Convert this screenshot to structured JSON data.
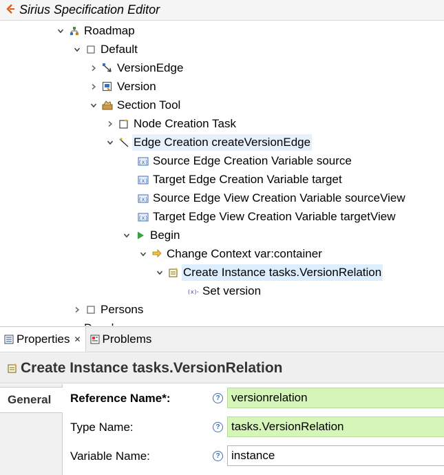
{
  "editor": {
    "title": "Sirius Specification Editor"
  },
  "tree": {
    "rows": [
      {
        "label": "Roadmap"
      },
      {
        "label": "Default"
      },
      {
        "label": "VersionEdge"
      },
      {
        "label": "Version"
      },
      {
        "label": "Section Tool"
      },
      {
        "label": "Node Creation Task"
      },
      {
        "label": "Edge Creation createVersionEdge"
      },
      {
        "label": "Source Edge Creation Variable source"
      },
      {
        "label": "Target Edge Creation Variable target"
      },
      {
        "label": "Source Edge View Creation Variable sourceView"
      },
      {
        "label": "Target Edge View Creation Variable targetView"
      },
      {
        "label": "Begin"
      },
      {
        "label": "Change Context var:container"
      },
      {
        "label": "Create Instance tasks.VersionRelation"
      },
      {
        "label": "Set version"
      },
      {
        "label": "Persons"
      },
      {
        "label": "Develop"
      }
    ]
  },
  "views": {
    "properties_tab": "Properties",
    "problems_tab": "Problems"
  },
  "properties": {
    "header_title": "Create Instance tasks.VersionRelation",
    "side_tab": "General",
    "fields": [
      {
        "label": "Reference Name*:",
        "value": "versionrelation"
      },
      {
        "label": "Type Name:",
        "value": "tasks.VersionRelation"
      },
      {
        "label": "Variable Name:",
        "value": "instance"
      }
    ],
    "help_glyph": "?"
  },
  "colors": {
    "selection": "#ddeeff",
    "required_field": "#d6f5b8",
    "help_icon": "#3b6fb0"
  }
}
